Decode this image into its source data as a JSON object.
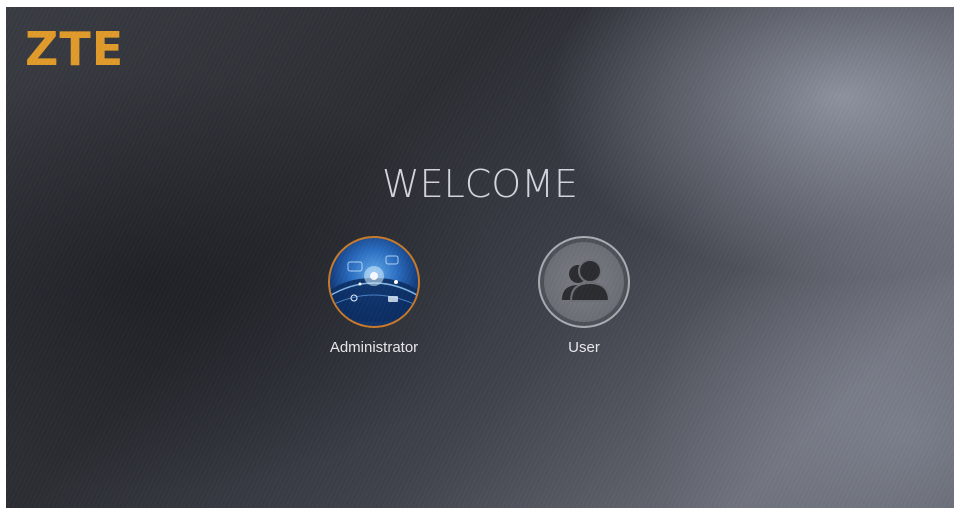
{
  "brand": {
    "logo_text": "ZTE",
    "logo_color": "#e09a2a"
  },
  "heading": "WELCOME",
  "accounts": [
    {
      "label": "Administrator",
      "icon": "globe-network-icon",
      "ring_color": "#c87a2a"
    },
    {
      "label": "User",
      "icon": "users-group-icon",
      "ring_color": "#a9acb3"
    }
  ]
}
